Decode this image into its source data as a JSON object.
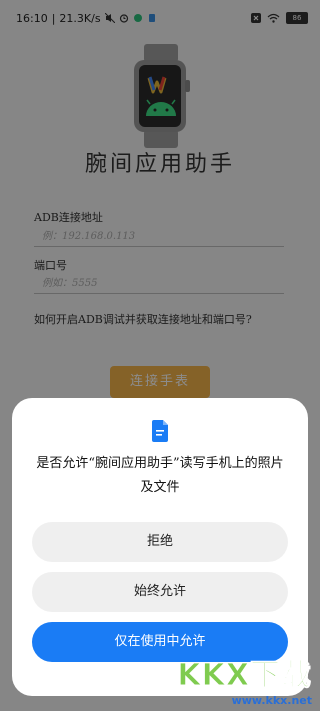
{
  "status_bar": {
    "time": "16:10",
    "separator": "|",
    "speed": "21.3K/s",
    "battery": "86"
  },
  "app": {
    "title": "腕间应用助手",
    "adb_label": "ADB连接地址",
    "adb_placeholder": "例：192.168.0.113",
    "port_label": "端口号",
    "port_placeholder": "例如：5555",
    "howto_link": "如何开启ADB调试并获取连接地址和端口号?",
    "connect_button": "连接手表"
  },
  "dialog": {
    "message": "是否允许“腕间应用助手”读写手机上的照片及文件",
    "deny": "拒绝",
    "always_allow": "始终允许",
    "allow_while_using": "仅在使用中允许"
  },
  "watermark": {
    "brand": "KKX下载",
    "url": "www.kkx.net"
  },
  "colors": {
    "accent": "#1a7cf5",
    "connect_button": "#f2b24a",
    "android_green": "#3ddc84"
  }
}
